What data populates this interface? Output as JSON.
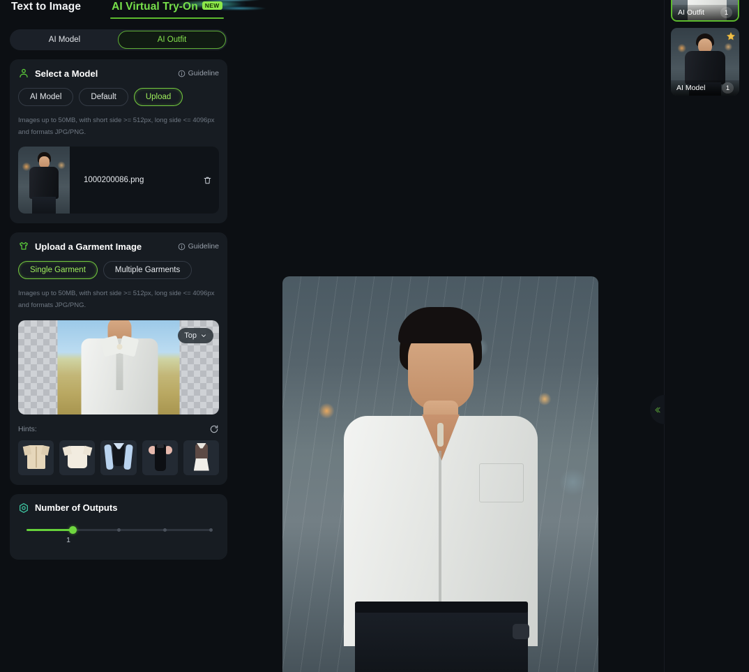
{
  "topbar": {
    "tabs": [
      {
        "label": "Text to Image",
        "active": false
      },
      {
        "label": "AI Virtual Try-On",
        "active": true,
        "badge": "NEW"
      }
    ]
  },
  "mode_switch": {
    "options": [
      {
        "label": "AI Model",
        "selected": false
      },
      {
        "label": "AI Outfit",
        "selected": true
      }
    ]
  },
  "select_model": {
    "title": "Select a Model",
    "icon": "person-icon",
    "guideline_label": "Guideline",
    "source_options": [
      {
        "label": "AI Model",
        "selected": false
      },
      {
        "label": "Default",
        "selected": false
      },
      {
        "label": "Upload",
        "selected": true
      }
    ],
    "upload_hint": "Images up to 50MB, with short side >= 512px, long side <= 4096px and formats JPG/PNG.",
    "file": {
      "name": "1000200086.png",
      "delete_icon": "trash-icon"
    }
  },
  "garment": {
    "title": "Upload a Garment Image",
    "icon": "tshirt-icon",
    "guideline_label": "Guideline",
    "mode_options": [
      {
        "label": "Single Garment",
        "selected": true
      },
      {
        "label": "Multiple Garments",
        "selected": false
      }
    ],
    "upload_hint": "Images up to 50MB, with short side >= 512px, long side <= 4096px and formats JPG/PNG.",
    "category_select": {
      "value": "Top",
      "icon": "chevron-down-icon"
    },
    "hints_label": "Hints:",
    "refresh_icon": "refresh-icon",
    "hint_items": [
      {
        "name": "beige-short-sleeve-shirt"
      },
      {
        "name": "cream-tshirt"
      },
      {
        "name": "blue-white-blouse-corset"
      },
      {
        "name": "black-puff-sleeve-dress"
      },
      {
        "name": "brown-white-pleated-dress"
      }
    ]
  },
  "outputs": {
    "title": "Number of Outputs",
    "icon": "target-icon",
    "value": "1",
    "min": 1,
    "max": 4,
    "ticks": [
      25,
      50,
      75,
      100
    ]
  },
  "preview": {
    "image_alt": "man-in-white-shirt-rainy-street"
  },
  "right_rail": {
    "collapse_icon": "chevrons-left-icon",
    "items": [
      {
        "label": "AI Outfit",
        "count": "1",
        "selected": true,
        "starred": false
      },
      {
        "label": "AI Model",
        "count": "1",
        "selected": false,
        "starred": true,
        "star_icon": "star-badge-icon"
      }
    ]
  },
  "colors": {
    "accent_green": "#77e04a",
    "accent_border": "#5fae37",
    "background": "#0c0f13",
    "card": "#171c22",
    "muted_text": "#6f7883"
  }
}
